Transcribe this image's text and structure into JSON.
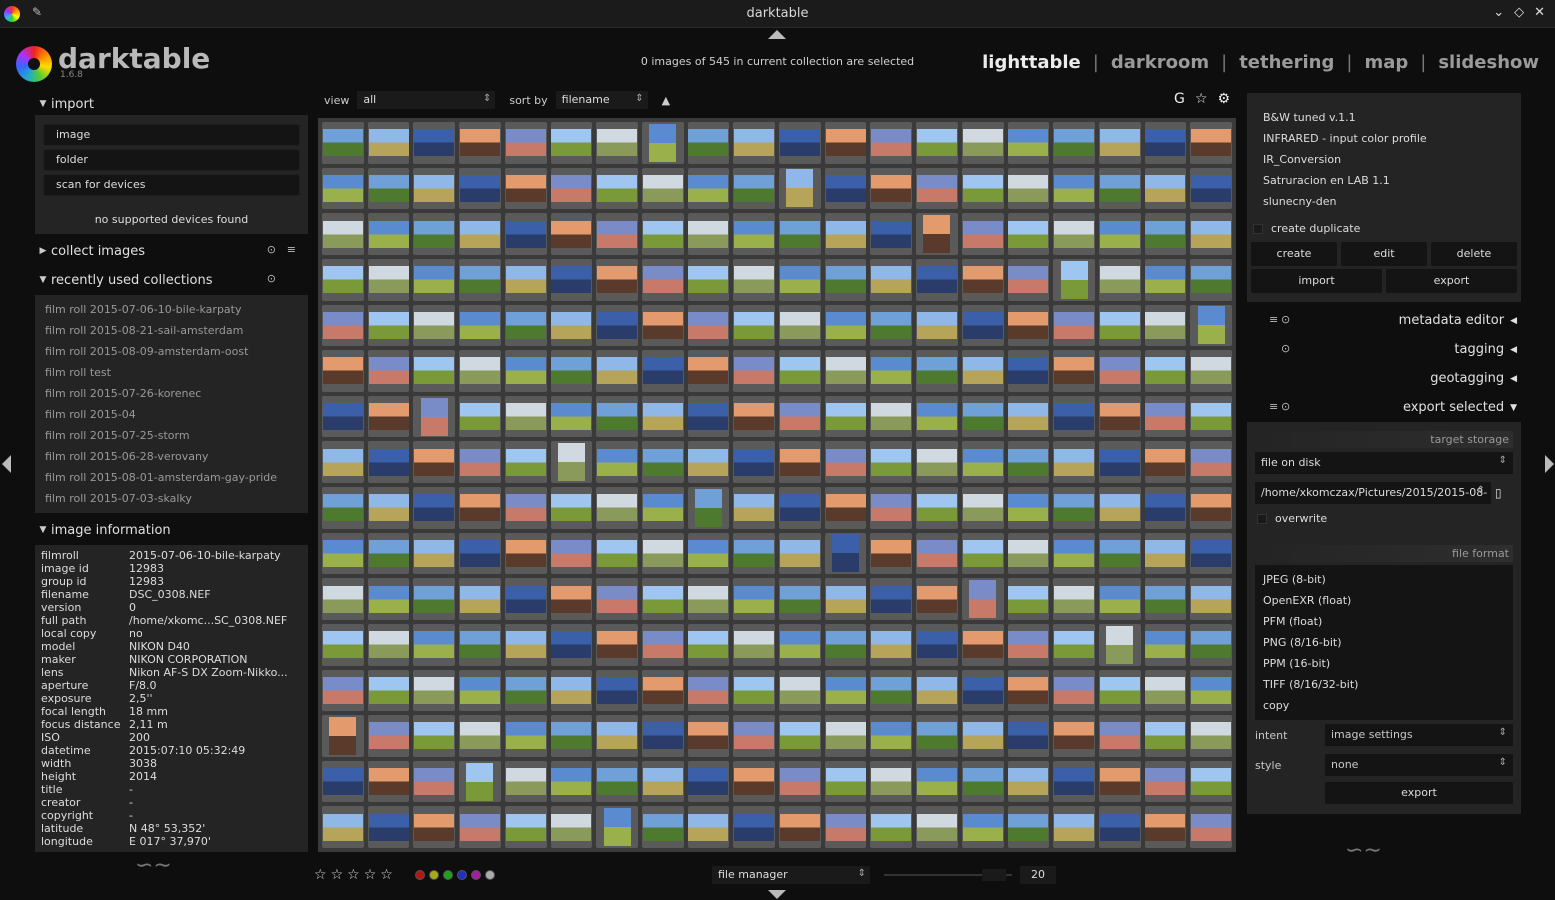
{
  "window": {
    "title": "darktable"
  },
  "app": {
    "name": "darktable",
    "version": "1.6.8"
  },
  "header": {
    "selection_info": "0 images of 545 in current collection are selected",
    "views": [
      "lighttable",
      "darkroom",
      "tethering",
      "map",
      "slideshow"
    ],
    "active_view": "lighttable"
  },
  "left": {
    "import": {
      "title": "import",
      "buttons": [
        "image",
        "folder",
        "scan for devices"
      ],
      "note": "no supported devices found"
    },
    "collect": {
      "title": "collect images"
    },
    "recent": {
      "title": "recently used collections",
      "items": [
        "film roll 2015-07-06-10-bile-karpaty",
        "film roll 2015-08-21-sail-amsterdam",
        "film roll 2015-08-09-amsterdam-oost",
        "film roll test",
        "film roll 2015-07-26-korenec",
        "film roll 2015-04",
        "film roll 2015-07-25-storm",
        "film roll 2015-06-28-verovany",
        "film roll 2015-08-01-amsterdam-gay-pride",
        "film roll 2015-07-03-skalky"
      ]
    },
    "info": {
      "title": "image information",
      "rows": [
        [
          "filmroll",
          "2015-07-06-10-bile-karpaty"
        ],
        [
          "image id",
          "12983"
        ],
        [
          "group id",
          "12983"
        ],
        [
          "filename",
          "DSC_0308.NEF"
        ],
        [
          "version",
          "0"
        ],
        [
          "full path",
          "/home/xkomc...SC_0308.NEF"
        ],
        [
          "local copy",
          "no"
        ],
        [
          "model",
          "NIKON D40"
        ],
        [
          "maker",
          "NIKON CORPORATION"
        ],
        [
          "lens",
          "Nikon AF-S DX Zoom-Nikko..."
        ],
        [
          "aperture",
          "F/8.0"
        ],
        [
          "exposure",
          "2,5''"
        ],
        [
          "focal length",
          "18 mm"
        ],
        [
          "focus distance",
          "2,11 m"
        ],
        [
          "ISO",
          "200"
        ],
        [
          "datetime",
          "2015:07:10 05:32:49"
        ],
        [
          "width",
          "3038"
        ],
        [
          "height",
          "2014"
        ],
        [
          "title",
          "-"
        ],
        [
          "creator",
          "-"
        ],
        [
          "copyright",
          "-"
        ],
        [
          "latitude",
          "N 48° 53,352'"
        ],
        [
          "longitude",
          "E 017° 37,970'"
        ]
      ]
    }
  },
  "center": {
    "view_label": "view",
    "view_value": "all",
    "sort_label": "sort by",
    "sort_value": "filename",
    "sort_dir": "▲",
    "icons": [
      "G",
      "☆",
      "⚙"
    ],
    "bottom": {
      "stars": [
        "☆",
        "☆",
        "☆",
        "☆",
        "☆"
      ],
      "colors": [
        "#b01818",
        "#a8a818",
        "#20a020",
        "#2030c0",
        "#a020a0",
        "#aaaaaa"
      ],
      "layout": "file manager",
      "zoom": "20"
    }
  },
  "right": {
    "styles": [
      "B&W tuned v.1.1",
      "INFRARED - input color profile",
      "IR_Conversion",
      "Satruracion en LAB 1.1",
      "slunecny-den"
    ],
    "create_duplicate": "create duplicate",
    "buttons1": [
      "create",
      "edit",
      "delete"
    ],
    "buttons2": [
      "import",
      "export"
    ],
    "modules": [
      {
        "title": "metadata editor",
        "arrow": "◀",
        "i1": "≡",
        "i2": "⊙"
      },
      {
        "title": "tagging",
        "arrow": "◀",
        "i1": "",
        "i2": "⊙"
      },
      {
        "title": "geotagging",
        "arrow": "◀",
        "i1": "",
        "i2": ""
      },
      {
        "title": "export selected",
        "arrow": "▼",
        "i1": "≡",
        "i2": "⊙"
      }
    ],
    "export": {
      "target_storage": "target storage",
      "storage": "file on disk",
      "path": "/home/xkomczax/Pictures/2015/2015-08-",
      "overwrite": "overwrite",
      "file_format": "file format",
      "formats": [
        "JPEG (8-bit)",
        "OpenEXR (float)",
        "PFM (float)",
        "PNG (8/16-bit)",
        "PPM (16-bit)",
        "TIFF (8/16/32-bit)",
        "copy"
      ],
      "intent_label": "intent",
      "intent": "image settings",
      "style_label": "style",
      "style": "none",
      "export_btn": "export"
    }
  }
}
